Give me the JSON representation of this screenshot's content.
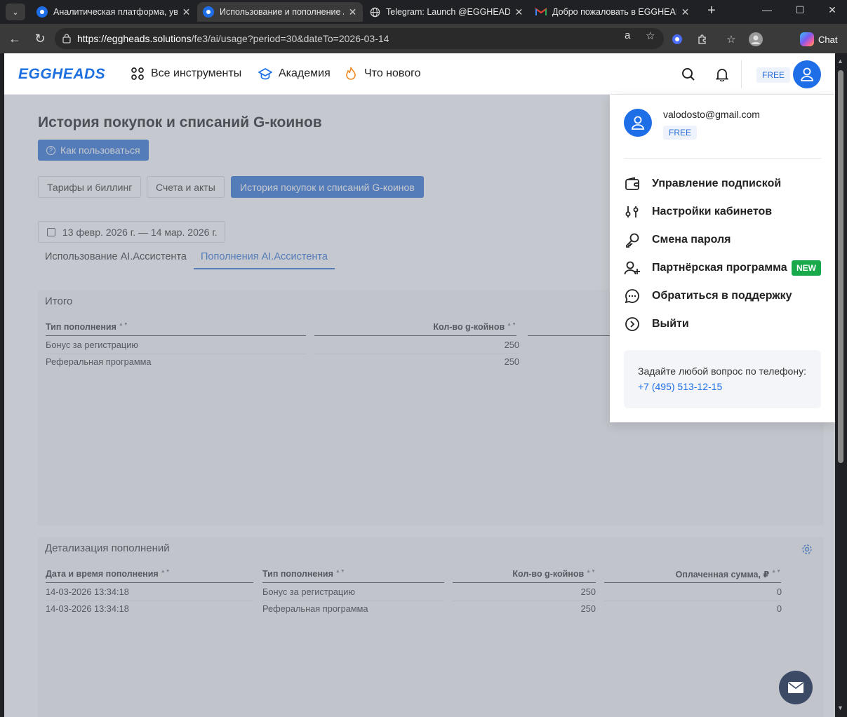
{
  "browser": {
    "tabs": [
      {
        "title": "Аналитическая платформа, увел",
        "active": false,
        "icon": "eggheads-favicon"
      },
      {
        "title": "Использование и пополнение AI",
        "active": true,
        "icon": "eggheads-favicon"
      },
      {
        "title": "Telegram: Launch @EGGHEADSM",
        "active": false,
        "icon": "globe-icon"
      },
      {
        "title": "Добро пожаловать в EGGHEADS",
        "active": false,
        "icon": "gmail-icon"
      }
    ],
    "url_host": "https://eggheads.solutions",
    "url_path": "/fe3/ai/usage?period=30&dateTo=2026-03-14",
    "chat_label": "Chat"
  },
  "header": {
    "logo": "EGGHEADS",
    "nav": [
      {
        "label": "Все инструменты",
        "icon": "grid-icon"
      },
      {
        "label": "Академия",
        "icon": "graduation-cap-icon"
      },
      {
        "label": "Что нового",
        "icon": "flame-icon"
      }
    ],
    "plan_badge": "FREE"
  },
  "page": {
    "title": "История покупок и списаний G-коинов",
    "howto_label": "Как пользоваться",
    "segments": [
      "Тарифы и биллинг",
      "Счета и акты",
      "История покупок и списаний G-коинов"
    ],
    "active_segment": 2,
    "date_range": "13 февр. 2026 г. — 14 мар. 2026 г.",
    "subtabs": [
      "Использование AI.Ассистента",
      "Пополнения AI.Ассистента"
    ],
    "active_subtab": 1
  },
  "summary": {
    "title": "Итого",
    "columns": [
      "Тип пополнения",
      "Кол-во g-койнов"
    ],
    "rows": [
      {
        "type": "Бонус за регистрацию",
        "amount": "250"
      },
      {
        "type": "Реферальная программа",
        "amount": "250"
      }
    ]
  },
  "details": {
    "title": "Детализация пополнений",
    "columns": [
      "Дата и время пополнения",
      "Тип пополнения",
      "Кол-во g-койнов",
      "Оплаченная сумма, ₽"
    ],
    "rows": [
      {
        "datetime": "14-03-2026 13:34:18",
        "type": "Бонус за регистрацию",
        "amount": "250",
        "paid": "0"
      },
      {
        "datetime": "14-03-2026 13:34:18",
        "type": "Реферальная программа",
        "amount": "250",
        "paid": "0"
      }
    ]
  },
  "user_menu": {
    "email": "valodosto@gmail.com",
    "plan": "FREE",
    "items": [
      {
        "label": "Управление подпиской",
        "icon": "wallet-icon"
      },
      {
        "label": "Настройки кабинетов",
        "icon": "sliders-icon"
      },
      {
        "label": "Смена пароля",
        "icon": "key-icon"
      },
      {
        "label": "Партнёрская программа",
        "icon": "user-plus-icon",
        "badge": "NEW"
      },
      {
        "label": "Обратиться в поддержку",
        "icon": "chat-bubble-icon"
      },
      {
        "label": "Выйти",
        "icon": "logout-icon"
      }
    ],
    "help_text": "Задайте любой вопрос по телефону:",
    "help_phone": "+7 (495) 513-12-15"
  },
  "colors": {
    "brand": "#1e6ee8",
    "accent_button": "#2f74d9",
    "new_badge": "#17a94a"
  }
}
